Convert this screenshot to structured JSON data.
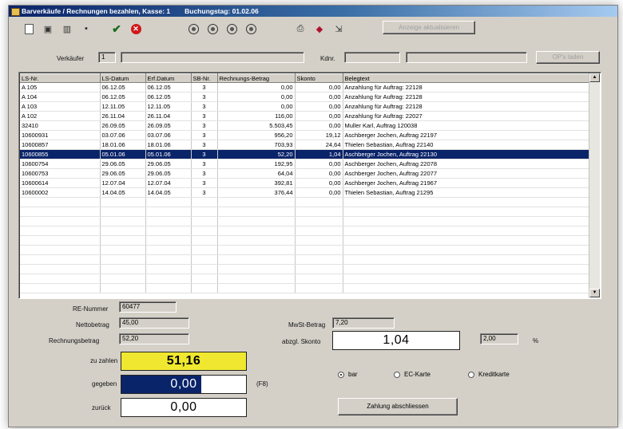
{
  "window": {
    "title": "Barverkäufe / Rechnungen bezahlen, Kasse: 1",
    "booking_label": "Buchungstag: 01.02.06"
  },
  "toolbar": {
    "print_preview_label": "Anzeige aktualisieren"
  },
  "header": {
    "seller_label": "Verkäufer",
    "seller_value": "1",
    "seller_name": "",
    "customer_label": "Kdnr.",
    "customer_value": "",
    "customer_name": "",
    "op_button_label": "OP's laden"
  },
  "grid": {
    "columns": [
      "LS-Nr.",
      "LS-Datum",
      "Erf.Datum",
      "SB-Nr.",
      "Rechnungs-Betrag",
      "Skonto",
      "Belegtext"
    ],
    "rows": [
      {
        "ls": "A 105",
        "ls_date": "06.12.05",
        "erf_date": "06.12.05",
        "sb": "3",
        "amount": "0,00",
        "skonto": "0,00",
        "text": "Anzahlung für Auftrag: 22128"
      },
      {
        "ls": "A 104",
        "ls_date": "06.12.05",
        "erf_date": "06.12.05",
        "sb": "3",
        "amount": "0,00",
        "skonto": "0,00",
        "text": "Anzahlung für Auftrag: 22128"
      },
      {
        "ls": "A 103",
        "ls_date": "12.11.05",
        "erf_date": "12.11.05",
        "sb": "3",
        "amount": "0,00",
        "skonto": "0,00",
        "text": "Anzahlung für Auftrag: 22128"
      },
      {
        "ls": "A 102",
        "ls_date": "26.11.04",
        "erf_date": "26.11.04",
        "sb": "3",
        "amount": "116,00",
        "skonto": "0,00",
        "text": "Anzahlung für Auftrag: 22027"
      },
      {
        "ls": "32410",
        "ls_date": "26.09.05",
        "erf_date": "26.09.05",
        "sb": "3",
        "amount": "5.503,45",
        "skonto": "0,00",
        "text": "Muller Karl, Auftrag 120038"
      },
      {
        "ls": "10600931",
        "ls_date": "03.07.06",
        "erf_date": "03.07.06",
        "sb": "3",
        "amount": "956,20",
        "skonto": "19,12",
        "text": "Aschberger Jochen, Auftrag 22197"
      },
      {
        "ls": "10600857",
        "ls_date": "18.01.06",
        "erf_date": "18.01.06",
        "sb": "3",
        "amount": "703,93",
        "skonto": "24,64",
        "text": "Thielen Sebastian, Auftrag 22140"
      },
      {
        "ls": "10600855",
        "ls_date": "05.01.06",
        "erf_date": "05.01.06",
        "sb": "3",
        "amount": "52,20",
        "skonto": "1,04",
        "text": "Aschberger Jochen, Auftrag 22130"
      },
      {
        "ls": "10600754",
        "ls_date": "29.06.05",
        "erf_date": "29.06.05",
        "sb": "3",
        "amount": "192,95",
        "skonto": "0,00",
        "text": "Aschberger Jochen, Auftrag 22078"
      },
      {
        "ls": "10600753",
        "ls_date": "29.06.05",
        "erf_date": "29.06.05",
        "sb": "3",
        "amount": "64,04",
        "skonto": "0,00",
        "text": "Aschberger Jochen, Auftrag 22077"
      },
      {
        "ls": "10600614",
        "ls_date": "12.07.04",
        "erf_date": "12.07.04",
        "sb": "3",
        "amount": "392,81",
        "skonto": "0,00",
        "text": "Aschberger Jochen, Auftrag 21967"
      },
      {
        "ls": "10600002",
        "ls_date": "14.04.05",
        "erf_date": "14.04.05",
        "sb": "3",
        "amount": "376,44",
        "skonto": "0,00",
        "text": "Thielen Sebastian, Auftrag 21295"
      }
    ],
    "selected_index": 7
  },
  "footer": {
    "re_number_label": "RE-Nummer",
    "re_number_value": "60477",
    "net_label": "Nettobetrag",
    "net_value": "45,00",
    "invoice_label": "Rechnungsbetrag",
    "invoice_value": "52,20",
    "vat_label": "MwSt-Betrag",
    "vat_value": "7,20",
    "discount_label": "abzgl. Skonto",
    "discount_value": "1,04",
    "discount_percent": "2,00",
    "percent_sign": "%",
    "to_pay_label": "zu zahlen",
    "to_pay_value": "51,16",
    "given_label": "gegeben",
    "given_value": "0,00",
    "given_hint": "(F8)",
    "change_label": "zurück",
    "change_value": "0,00",
    "payment_options": [
      "bar",
      "EC-Karte",
      "Kreditkarte"
    ],
    "payment_selected": 0,
    "finish_button_label": "Zahlung abschliessen"
  },
  "colors": {
    "title_bar": "#0a246a",
    "selection": "#0a246a",
    "to_pay_bg": "#f0e830",
    "given_bg": "#0a246a"
  }
}
